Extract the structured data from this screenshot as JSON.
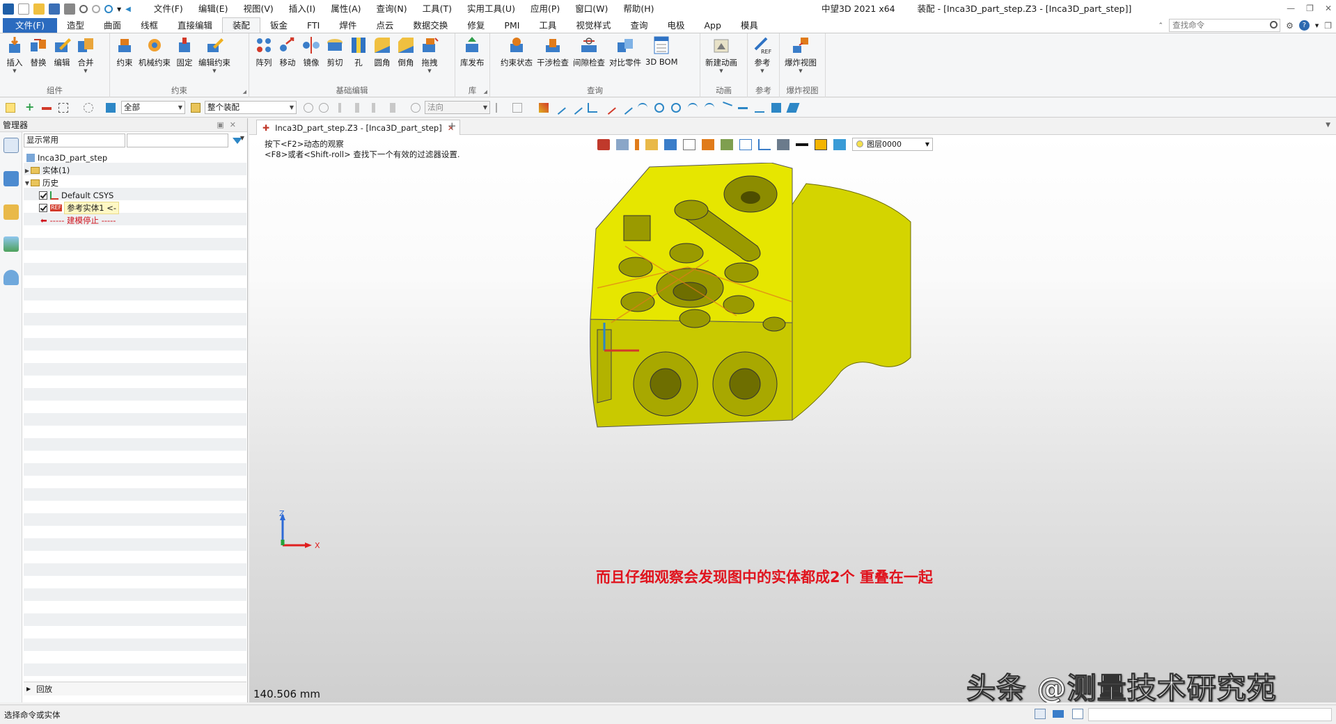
{
  "titlebar": {
    "menu": [
      "文件(F)",
      "编辑(E)",
      "视图(V)",
      "插入(I)",
      "属性(A)",
      "查询(N)",
      "工具(T)",
      "实用工具(U)",
      "应用(P)",
      "窗口(W)",
      "帮助(H)"
    ],
    "app_name": "中望3D 2021 x64",
    "doc_title": "装配 - [Inca3D_part_step.Z3 - [Inca3D_part_step]]"
  },
  "ribbon_tabs": {
    "file": "文件(F)",
    "items": [
      "造型",
      "曲面",
      "线框",
      "直接编辑",
      "装配",
      "钣金",
      "FTI",
      "焊件",
      "点云",
      "数据交换",
      "修复",
      "PMI",
      "工具",
      "视觉样式",
      "查询",
      "电极",
      "App",
      "模具"
    ],
    "active": "装配",
    "search_placeholder": "查找命令"
  },
  "ribbon": {
    "groups": [
      {
        "label": "组件",
        "buttons": [
          "插入",
          "替换",
          "编辑",
          "合并"
        ]
      },
      {
        "label": "约束",
        "buttons": [
          "约束",
          "机械约束",
          "固定",
          "编辑约束"
        ]
      },
      {
        "label": "基础编辑",
        "buttons": [
          "阵列",
          "移动",
          "镜像",
          "剪切",
          "孔",
          "圆角",
          "倒角",
          "拖拽"
        ]
      },
      {
        "label": "库",
        "buttons": [
          "库发布"
        ]
      },
      {
        "label": "查询",
        "buttons": [
          "约束状态",
          "干涉检查",
          "间隙检查",
          "对比零件",
          "3D BOM"
        ]
      },
      {
        "label": "动画",
        "buttons": [
          "新建动画"
        ]
      },
      {
        "label": "参考",
        "buttons": [
          "参考"
        ]
      },
      {
        "label": "爆炸视图",
        "buttons": [
          "爆炸视图"
        ]
      }
    ]
  },
  "toolbar": {
    "filter_combo": "全部",
    "scope_combo": "整个装配",
    "normal_combo": "法向"
  },
  "manager": {
    "title": "管理器",
    "display_combo": "显示常用",
    "tree": {
      "root": "Inca3D_part_step",
      "solid": "实体(1)",
      "history": "历史",
      "csys": "Default CSYS",
      "ref_solid": "参考实体1 <-",
      "stop": "----- 建模停止 -----"
    },
    "rollback": "回放"
  },
  "document": {
    "tab_label": "Inca3D_part_step.Z3 - [Inca3D_part_step]",
    "hint_line1": "按下<F2>动态的观察",
    "hint_line2": "<F8>或者<Shift-roll> 查找下一个有效的过滤器设置.",
    "layer": "图层0000",
    "caption": "而且仔细观察会发现图中的实体都成2个 重叠在一起",
    "scale": "140.506 mm",
    "watermark": "头条 @测量技术研究苑",
    "axis_x": "X",
    "axis_z": "Z"
  },
  "status": {
    "message": "选择命令或实体"
  },
  "colors": {
    "part_fill": "#e6e600",
    "accent": "#2b6bbf",
    "caption": "#e0141e"
  }
}
